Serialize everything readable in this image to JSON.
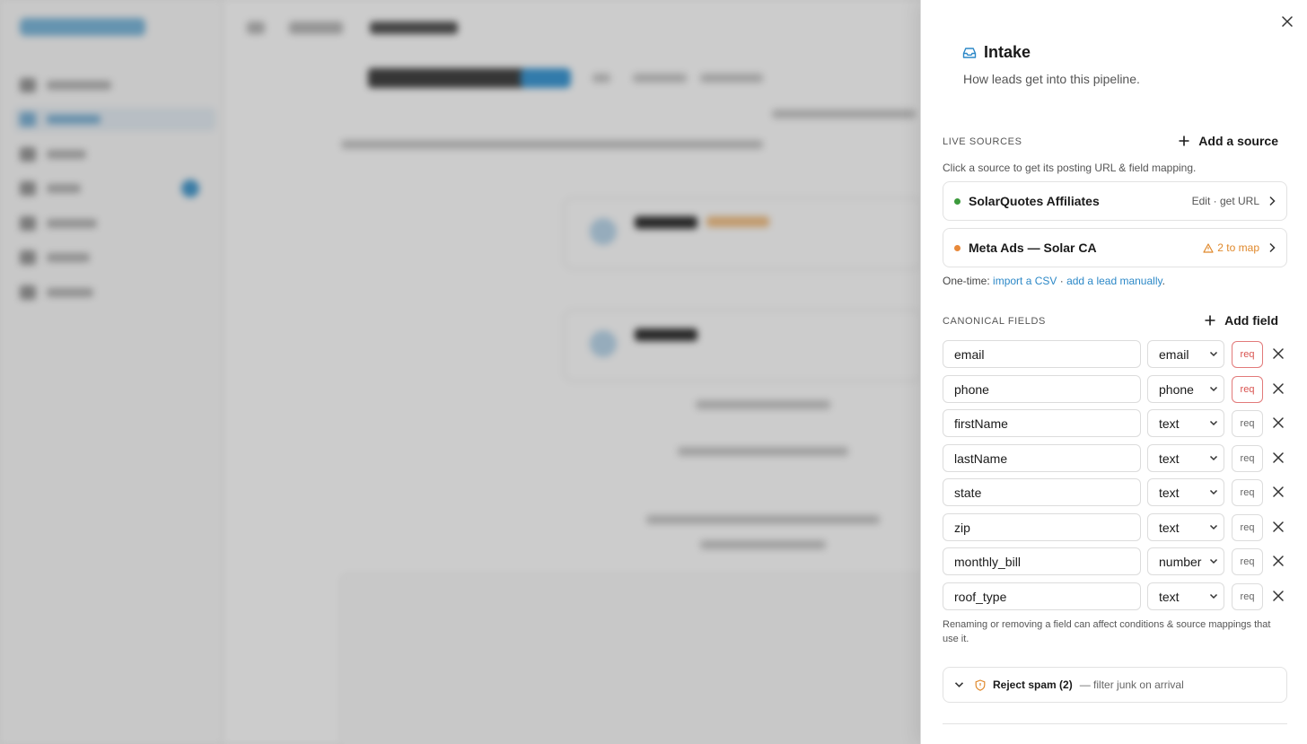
{
  "drawer": {
    "title": "Intake",
    "subtitle": "How leads get into this pipeline.",
    "live_sources": {
      "label": "LIVE SOURCES",
      "add_label": "Add a source",
      "hint": "Click a source to get its posting URL & field mapping.",
      "items": [
        {
          "name": "SolarQuotes Affiliates",
          "meta": "Edit · get URL",
          "status_color": "#3c9a3c"
        },
        {
          "name": "Meta Ads — Solar CA",
          "meta": "2 to map",
          "status_color": "#e8893a",
          "warning": true
        }
      ]
    },
    "one_time": {
      "prefix": "One-time:",
      "csv_link": "import a CSV",
      "separator": "·",
      "manual_link": "add a lead manually",
      "suffix": "."
    },
    "canonical_fields": {
      "label": "CANONICAL FIELDS",
      "add_label": "Add field",
      "req_label": "req",
      "fields": [
        {
          "name": "email",
          "type": "email",
          "required": true
        },
        {
          "name": "phone",
          "type": "phone",
          "required": true
        },
        {
          "name": "firstName",
          "type": "text",
          "required": false
        },
        {
          "name": "lastName",
          "type": "text",
          "required": false
        },
        {
          "name": "state",
          "type": "text",
          "required": false
        },
        {
          "name": "zip",
          "type": "text",
          "required": false
        },
        {
          "name": "monthly_bill",
          "type": "number",
          "required": false
        },
        {
          "name": "roof_type",
          "type": "text",
          "required": false
        }
      ],
      "note": "Renaming or removing a field can affect conditions & source mappings that use it."
    },
    "rule": {
      "title": "Reject spam (2)",
      "desc": "— filter junk on arrival"
    }
  },
  "colors": {
    "link": "#2c88c7",
    "warning": "#e0892c",
    "required": "#d9534f"
  }
}
